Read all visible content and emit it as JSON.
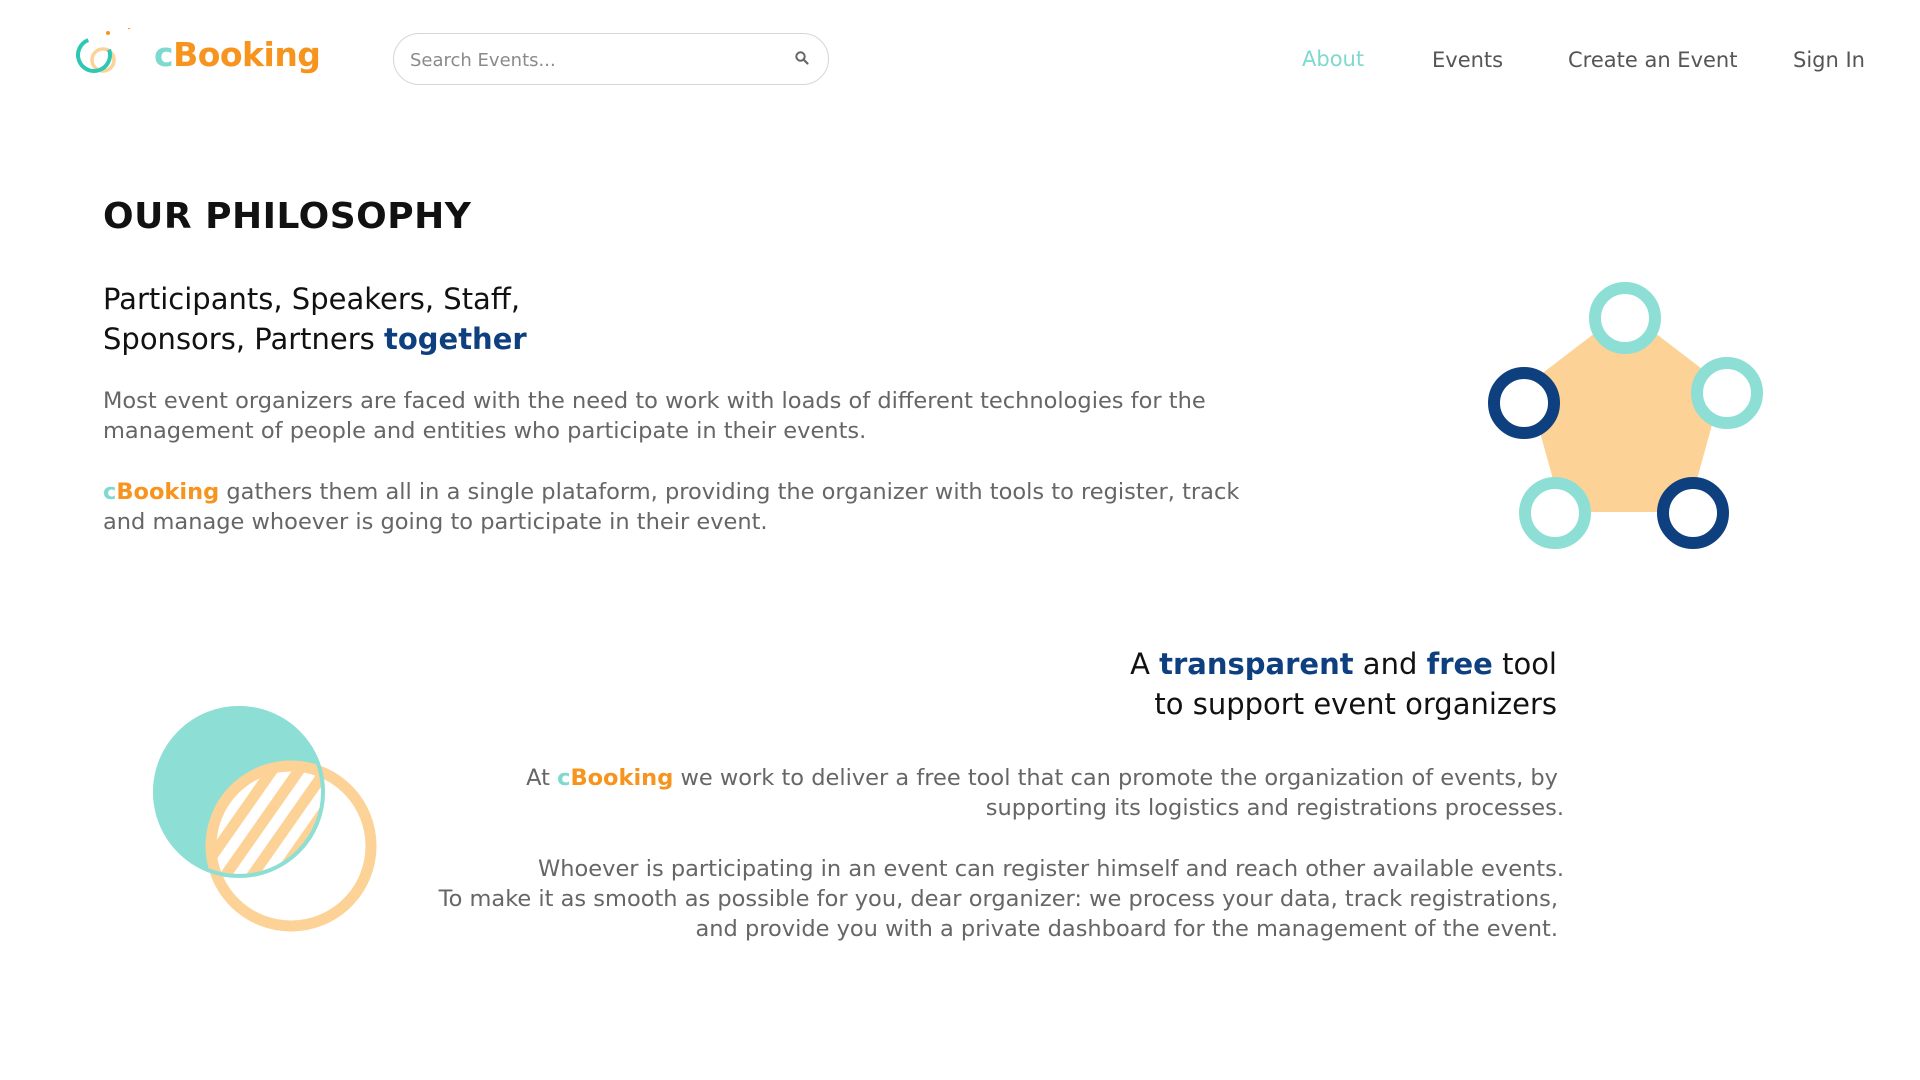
{
  "header": {
    "brand": {
      "prefix": "c",
      "name": "Booking"
    },
    "search": {
      "placeholder": "Search Events...",
      "value": ""
    },
    "nav": {
      "about": "About",
      "events": "Events",
      "create_event": "Create an Event",
      "sign_in": "Sign In"
    }
  },
  "philosophy": {
    "heading": "OUR PHILOSOPHY",
    "subtitle_line1": "Participants, Speakers, Staff,",
    "subtitle_line2_pre": "Sponsors, Partners ",
    "subtitle_line2_emph": "together",
    "p1_line1": "Most event organizers are faced with the need to work with loads of different technologies for the",
    "p1_line2": "management of people and entities who participate in their events.",
    "p2_brand_prefix": "c",
    "p2_brand_name": "Booking",
    "p2_line1_rest": " gathers them all in a single plataform, providing the organizer with tools to register, track",
    "p2_line2": "and manage whoever is going to participate in their event."
  },
  "transparent": {
    "title_a": "A ",
    "title_transparent": "transparent",
    "title_and": " and ",
    "title_free": "free",
    "title_tool": " tool",
    "title_line2": "to support event organizers",
    "p1_at": "At ",
    "p1_brand_prefix": "c",
    "p1_brand_name": "Booking",
    "p1_line1_rest": " we work to deliver a free tool that can promote the organization of events, by",
    "p1_line2": "supporting its logistics and registrations processes.",
    "p2_line1": "Whoever is participating in an event can register himself and reach other available events.",
    "p2_line2": "To make it as smooth as possible for you, dear organizer: we process your data, track registrations,",
    "p2_line3": "and provide you with a private dashboard for the management of the event."
  },
  "colors": {
    "teal": "#7ed9cf",
    "orange": "#f7941d",
    "navy": "#0e3f7e",
    "peach": "#fdd296"
  },
  "icons": [
    "logo-icon",
    "search-icon",
    "pentagon-network-illustration",
    "overlapping-circles-illustration"
  ]
}
